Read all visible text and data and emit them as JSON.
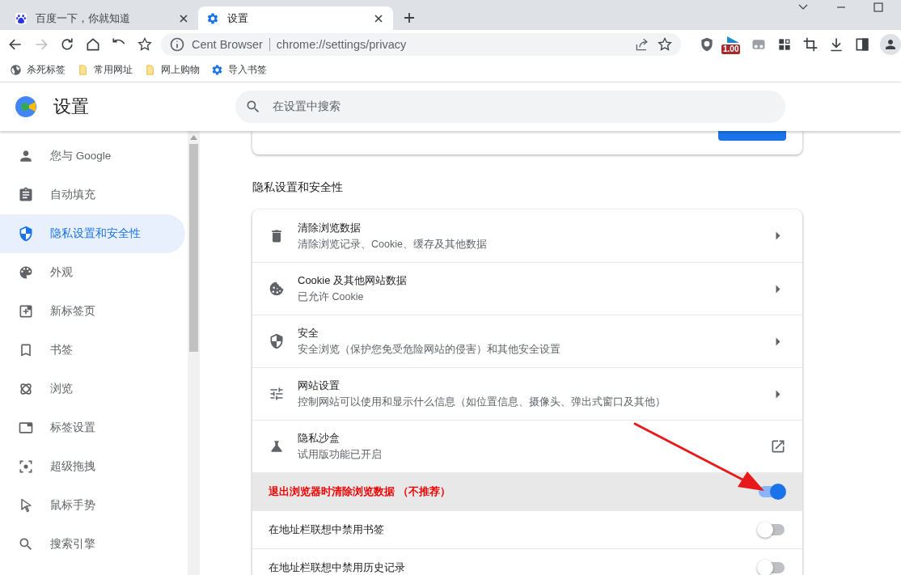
{
  "tabs": [
    {
      "title": "百度一下，你就知道",
      "selected": false
    },
    {
      "title": "设置",
      "selected": true
    }
  ],
  "address_bar": {
    "site": "Cent Browser",
    "url": "chrome://settings/privacy"
  },
  "extension_badge": "1.00",
  "bookmarks": [
    {
      "label": "杀死标签",
      "kind": "special"
    },
    {
      "label": "常用网址",
      "kind": "folder"
    },
    {
      "label": "网上购物",
      "kind": "folder"
    },
    {
      "label": "导入书签",
      "kind": "import"
    }
  ],
  "header": {
    "title": "设置",
    "search_placeholder": "在设置中搜索"
  },
  "sidebar": {
    "items": [
      {
        "label": "您与 Google",
        "selected": false
      },
      {
        "label": "自动填充",
        "selected": false
      },
      {
        "label": "隐私设置和安全性",
        "selected": true
      },
      {
        "label": "外观",
        "selected": false
      },
      {
        "label": "新标签页",
        "selected": false
      },
      {
        "label": "书签",
        "selected": false
      },
      {
        "label": "浏览",
        "selected": false
      },
      {
        "label": "标签设置",
        "selected": false
      },
      {
        "label": "超级拖拽",
        "selected": false
      },
      {
        "label": "鼠标手势",
        "selected": false
      },
      {
        "label": "搜索引擎",
        "selected": false
      }
    ]
  },
  "section_title": "隐私设置和安全性",
  "rows": [
    {
      "kind": "link",
      "title": "清除浏览数据",
      "subtitle": "清除浏览记录、Cookie、缓存及其他数据"
    },
    {
      "kind": "link",
      "title": "Cookie 及其他网站数据",
      "subtitle": "已允许 Cookie"
    },
    {
      "kind": "link",
      "title": "安全",
      "subtitle": "安全浏览（保护您免受危险网站的侵害）和其他安全设置"
    },
    {
      "kind": "link",
      "title": "网站设置",
      "subtitle": "控制网站可以使用和显示什么信息（如位置信息、摄像头、弹出式窗口及其他）"
    },
    {
      "kind": "external",
      "title": "隐私沙盒",
      "subtitle": "试用版功能已开启"
    },
    {
      "kind": "toggle",
      "title": "退出浏览器时清除浏览数据 （不推荐）",
      "on": true,
      "highlighted": true
    },
    {
      "kind": "toggle",
      "title": "在地址栏联想中禁用书签",
      "on": false,
      "highlighted": false
    },
    {
      "kind": "toggle",
      "title": "在地址栏联想中禁用历史记录",
      "on": false,
      "highlighted": false
    }
  ],
  "annotations": [
    {
      "kind": "arrow",
      "color": "#e8191a"
    }
  ]
}
